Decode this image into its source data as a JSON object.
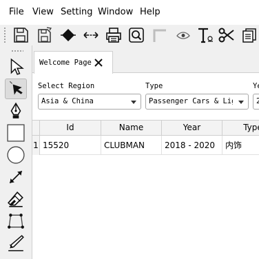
{
  "menu": [
    "File",
    "View",
    "Setting",
    "Window",
    "Help"
  ],
  "toolbar_icons": [
    "save-icon",
    "save-as-icon",
    "diamond-icon",
    "resize-horizontal-icon",
    "printer-icon",
    "zoom-icon",
    "corner-icon",
    "eye-icon",
    "text-icon",
    "scissors-icon",
    "copy-icon"
  ],
  "left_tools": [
    "select-arrow-icon",
    "direct-select-icon",
    "pen-nib-icon",
    "rectangle-icon",
    "circle-icon",
    "measure-icon",
    "eraser-icon",
    "polygon-icon",
    "pencil-icon"
  ],
  "tab": {
    "label": "Welcome Page"
  },
  "filters": {
    "region": {
      "label": "Select Region",
      "value": "Asia & China"
    },
    "type": {
      "label": "Type",
      "value": "Passenger Cars & Light"
    },
    "year": {
      "label": "Ye",
      "value": "2"
    }
  },
  "table": {
    "columns": [
      "Id",
      "Name",
      "Year",
      "Type"
    ],
    "rows": [
      {
        "num": "1",
        "cells": [
          "15520",
          "CLUBMAN",
          "2018 - 2020",
          "内饰"
        ]
      }
    ]
  }
}
